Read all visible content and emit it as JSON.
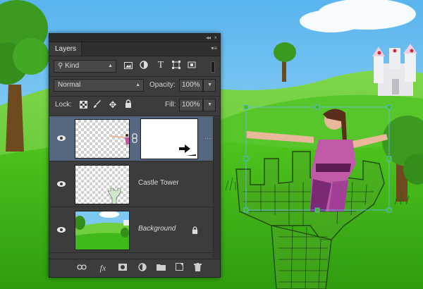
{
  "panel": {
    "tab_label": "Layers",
    "collapse_glyph": "◂◂",
    "close_glyph": "×",
    "menu_glyph": "▾≡"
  },
  "filter": {
    "kind_label": "Kind",
    "search_glyph": "⚲",
    "icons": [
      "image-filter-icon",
      "adjustment-filter-icon",
      "type-filter-icon",
      "shape-filter-icon",
      "smart-object-filter-icon"
    ],
    "type_glyph": "T"
  },
  "blend": {
    "mode": "Normal",
    "opacity_label": "Opacity:",
    "opacity_value": "100%"
  },
  "lock": {
    "label": "Lock:",
    "fill_label": "Fill:",
    "fill_value": "100%"
  },
  "layers": [
    {
      "name": "",
      "selected": true,
      "has_mask": true
    },
    {
      "name": "Castle Tower",
      "selected": false
    },
    {
      "name": "Background",
      "selected": false,
      "locked": true
    }
  ],
  "bottom_icons": [
    "link-layers-icon",
    "fx-icon",
    "add-mask-icon",
    "adjustment-layer-icon",
    "group-folder-icon",
    "new-layer-icon",
    "trash-icon"
  ],
  "fx_label": "fx",
  "colors": {
    "panel_bg": "#3c3c3c",
    "selection": "#55677f",
    "sky": "#8fd0f5",
    "grass": "#3fbf1a",
    "transform_box": "#63b5ff"
  }
}
